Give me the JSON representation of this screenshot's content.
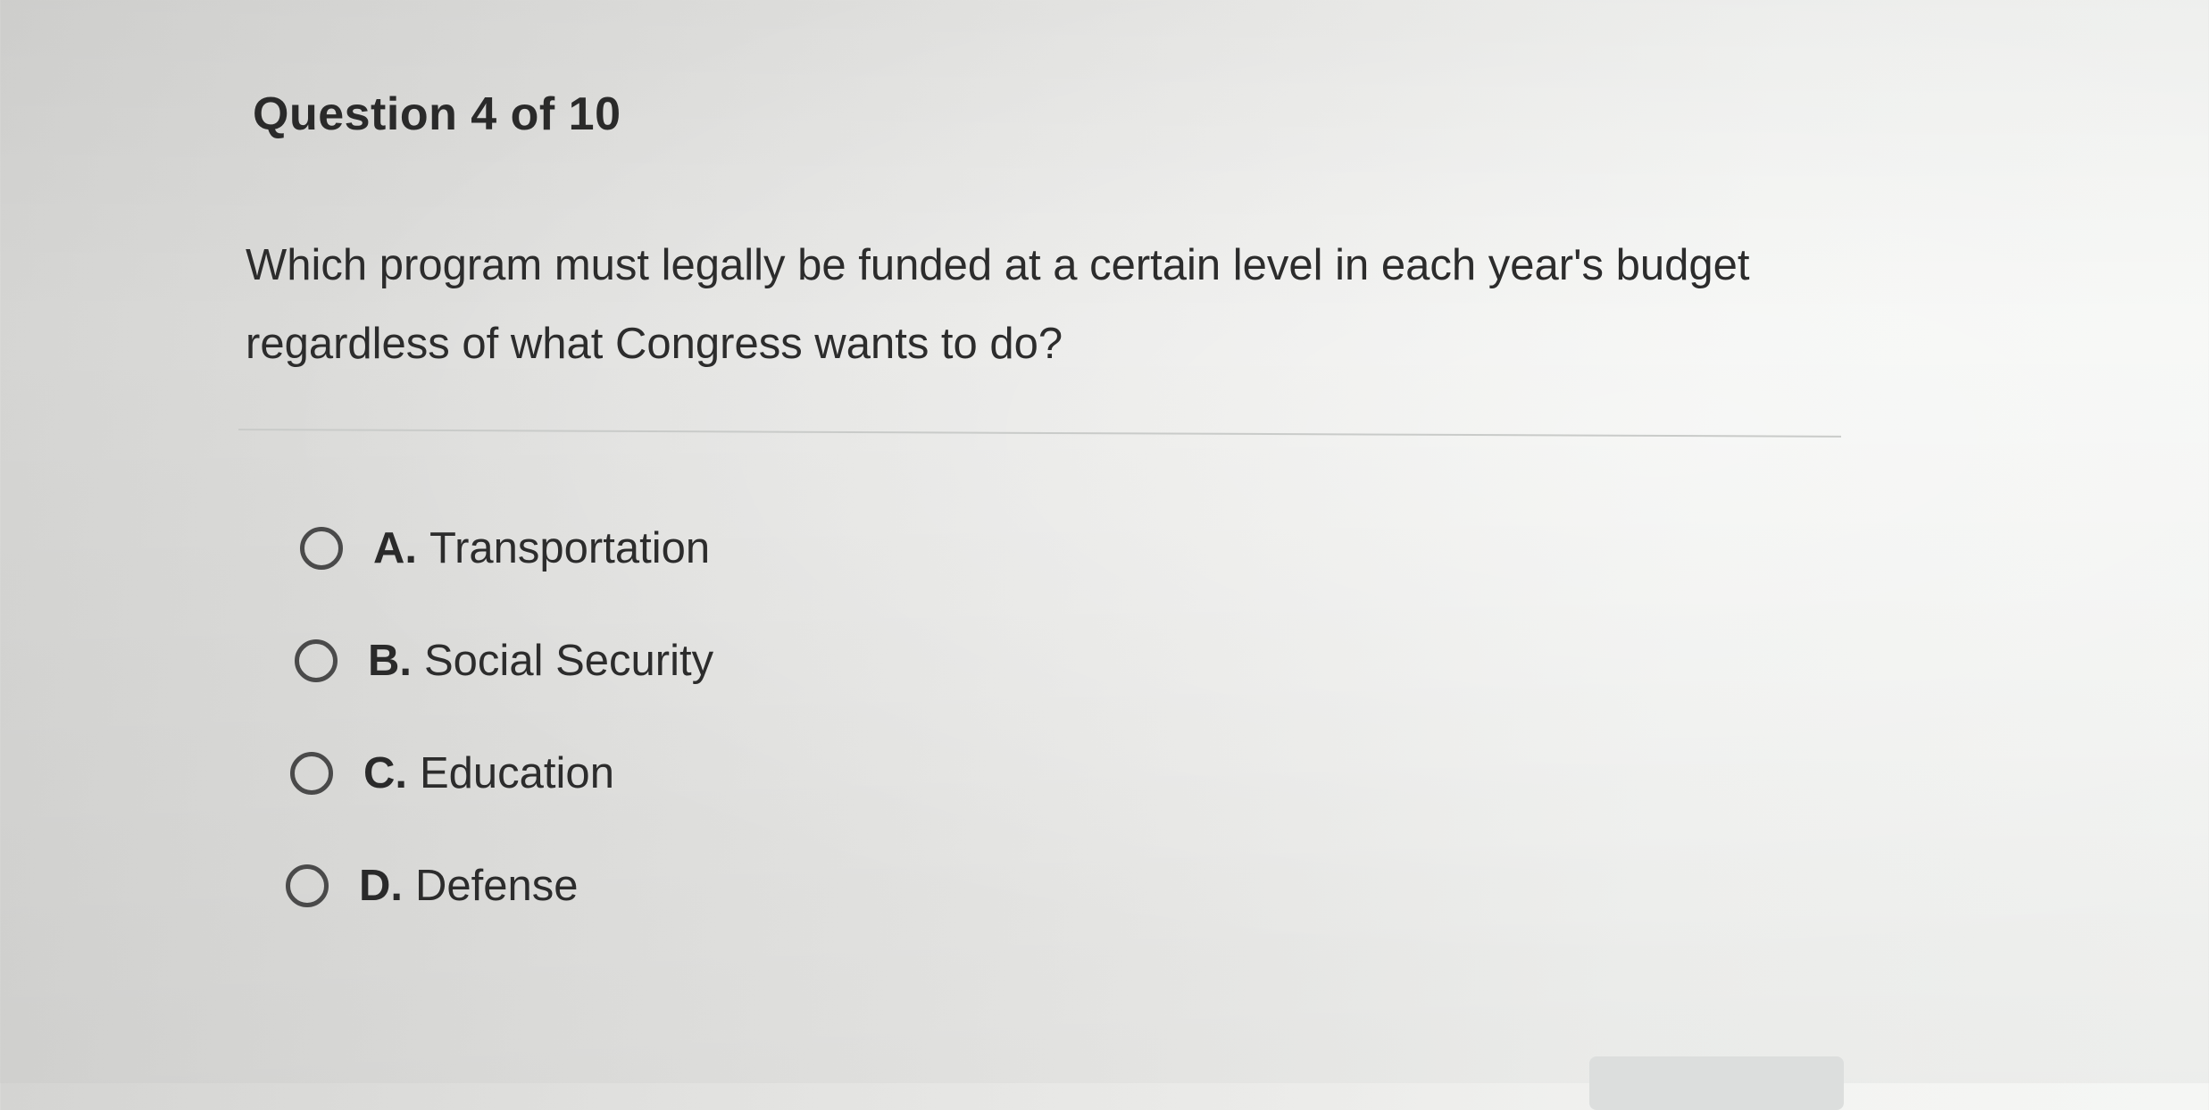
{
  "question": {
    "counter": "Question 4 of 10",
    "text": "Which program must legally be funded at a certain level in each year's budget regardless of what Congress wants to do?"
  },
  "options": [
    {
      "letter": "A.",
      "label": "Transportation",
      "selected": false
    },
    {
      "letter": "B.",
      "label": "Social Security",
      "selected": false
    },
    {
      "letter": "C.",
      "label": "Education",
      "selected": false
    },
    {
      "letter": "D.",
      "label": "Defense",
      "selected": false
    }
  ],
  "colors": {
    "text": "#2b2b2b",
    "radio_border": "#4a4a4a",
    "divider": "#c9cbc9"
  },
  "icons": {
    "option_marker": "radio-unselected-icon"
  }
}
